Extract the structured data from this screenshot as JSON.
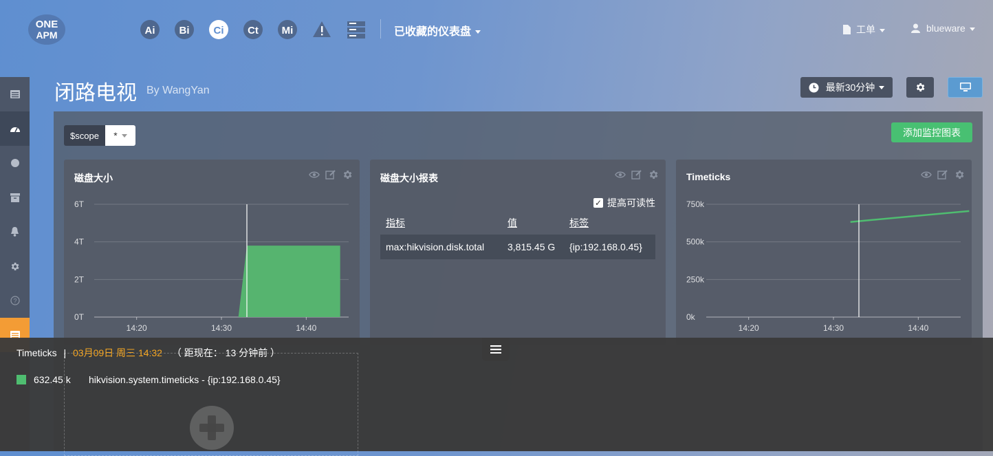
{
  "brand": {
    "logo_text_top": "ONE",
    "logo_text_bottom": "APM"
  },
  "nav": {
    "apps": [
      {
        "name": "ai-icon",
        "label": "Ai"
      },
      {
        "name": "bi-icon",
        "label": "Bi"
      },
      {
        "name": "ci-icon",
        "label": "Ci",
        "active": true
      },
      {
        "name": "ct-icon",
        "label": "Ct"
      },
      {
        "name": "mi-icon",
        "label": "Mi"
      }
    ],
    "favorites_label": "已收藏的仪表盘",
    "workorder_label": "工单",
    "user_label": "blueware"
  },
  "page": {
    "title": "闭路电视",
    "by": "By WangYan",
    "time_range_label": "最新30分钟",
    "scope_label": "$scope",
    "scope_value": "*",
    "add_chart_label": "添加监控图表"
  },
  "panels": {
    "disk_size": {
      "title": "磁盘大小"
    },
    "disk_table": {
      "title": "磁盘大小报表",
      "readability_label": "提高可读性",
      "columns": [
        "指标",
        "值",
        "标签"
      ],
      "rows": [
        [
          "max:hikvision.disk.total",
          "3,815.45 G",
          "{ip:192.168.0.45}"
        ]
      ]
    },
    "timeticks": {
      "title": "Timeticks"
    }
  },
  "chart_data": [
    {
      "type": "area",
      "title": "磁盘大小",
      "x_ticks": [
        "14:20",
        "14:30",
        "14:40"
      ],
      "y_ticks": [
        "0T",
        "2T",
        "4T",
        "6T"
      ],
      "ylim": [
        0,
        6
      ],
      "series": [
        {
          "x": [
            "14:32",
            "14:33",
            "14:44"
          ],
          "values": [
            0,
            3.8,
            3.8
          ]
        }
      ],
      "cursor": "14:33",
      "color": "#56b46f"
    },
    {
      "type": "line",
      "title": "Timeticks",
      "x_ticks": [
        "14:20",
        "14:30",
        "14:40"
      ],
      "y_ticks": [
        "0k",
        "250k",
        "500k",
        "750k"
      ],
      "ylim": [
        0,
        750
      ],
      "series": [
        {
          "x": [
            "14:32",
            "14:46"
          ],
          "values": [
            632.45,
            705
          ]
        }
      ],
      "cursor": "14:33",
      "color": "#4fbd70"
    }
  ],
  "tooltip": {
    "metric": "Timeticks",
    "separator": "|",
    "date": "03月09日 周三 14:32",
    "ago": "（ 距现在： 13 分钟前 ）",
    "value": "632.45 k",
    "series_label": "hikvision.system.timeticks - {ip:192.168.0.45}"
  },
  "colors": {
    "accent_green": "#48c072",
    "sidebar_active": "#f39c35",
    "primary_blue": "#5b9bd1"
  }
}
